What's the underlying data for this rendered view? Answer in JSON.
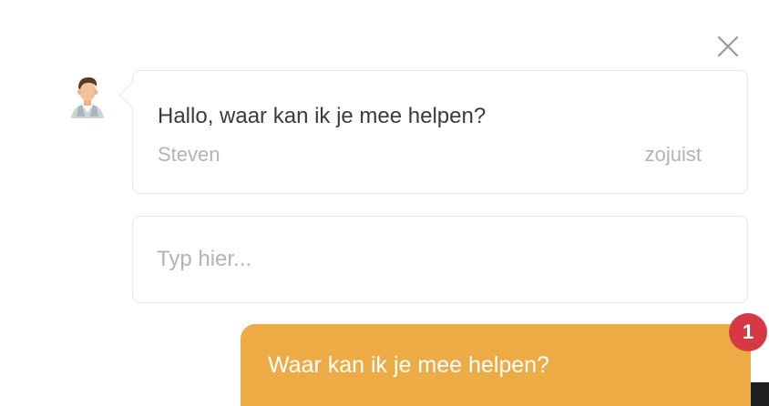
{
  "chat": {
    "message": {
      "text": "Hallo, waar kan ik je mee helpen?",
      "author": "Steven",
      "time": "zojuist"
    },
    "input": {
      "placeholder": "Typ hier..."
    },
    "launcher": {
      "label": "Waar kan ik je mee helpen?",
      "badge_count": "1"
    }
  },
  "colors": {
    "accent": "#ecab45",
    "badge": "#d63846",
    "border": "#e6e6e6",
    "muted_text": "#b3b3b3",
    "text": "#3a3a3a"
  },
  "icons": {
    "close": "close-icon",
    "avatar": "agent-avatar"
  }
}
